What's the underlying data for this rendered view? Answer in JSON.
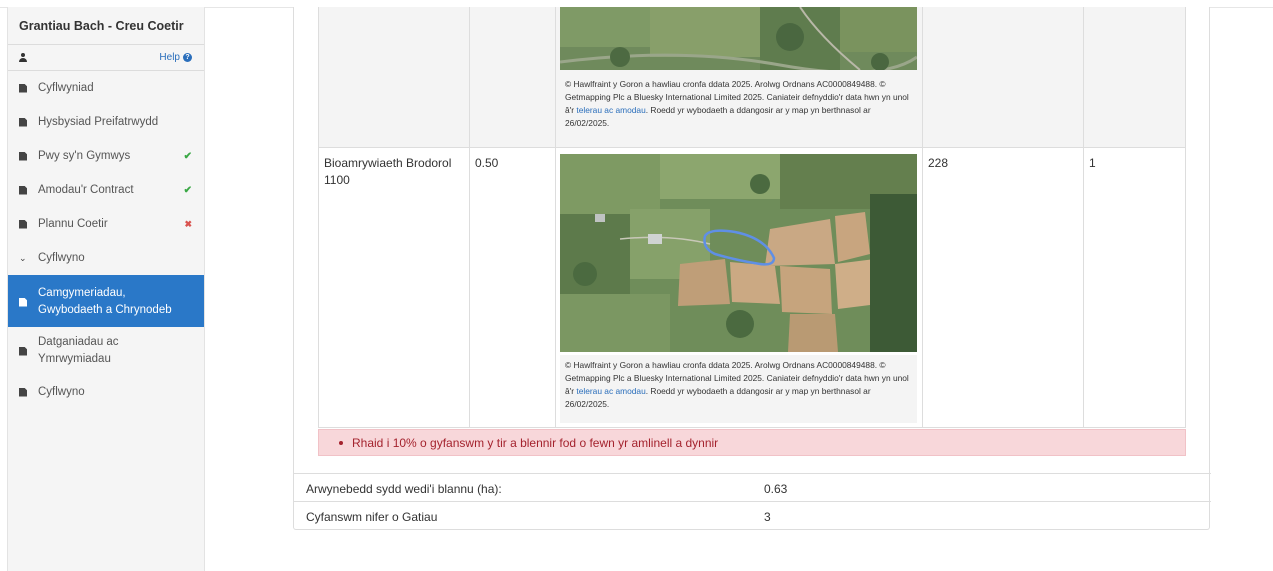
{
  "sidebar": {
    "title": "Grantiau Bach - Creu Coetir",
    "help_label": "Help",
    "items": [
      {
        "label": "Cyflwyniad",
        "status": ""
      },
      {
        "label": "Hysbysiad Preifatrwydd",
        "status": ""
      },
      {
        "label": "Pwy sy'n Gymwys",
        "status": "✔"
      },
      {
        "label": "Amodau'r Contract",
        "status": "✔"
      },
      {
        "label": "Plannu Coetir",
        "status": "✖"
      },
      {
        "label": "Cyflwyno",
        "status": ""
      },
      {
        "label": "Camgymeriadau, Gwybodaeth a Chrynodeb",
        "status": ""
      },
      {
        "label": "Datganiadau ac Ymrwymiadau",
        "status": ""
      },
      {
        "label": "Cyflwyno",
        "status": ""
      }
    ]
  },
  "table": {
    "rows": [
      {
        "name": "",
        "area": "",
        "caption_text": "© Hawlfraint y Goron a hawliau cronfa ddata 2025. Arolwg Ordnans AC0000849488. © Getmapping Plc a Bluesky International Limited 2025. Caniateir defnyddio'r data hwn yn unol â'r ",
        "caption_link": "telerau ac amodau",
        "caption_tail": ". Roedd yr wybodaeth a ddangosir ar y map yn berthnasol ar 26/02/2025.",
        "col4": "",
        "col5": ""
      },
      {
        "name": "Bioamrywiaeth Brodorol 1100",
        "area": "0.50",
        "caption_text": "© Hawlfraint y Goron a hawliau cronfa ddata 2025. Arolwg Ordnans AC0000849488. © Getmapping Plc a Bluesky International Limited 2025. Caniateir defnyddio'r data hwn yn unol â'r ",
        "caption_link": "telerau ac amodau",
        "caption_tail": ". Roedd yr wybodaeth a ddangosir ar y map yn berthnasol ar 26/02/2025.",
        "col4": "228",
        "col5": "1"
      }
    ]
  },
  "alert": {
    "message": "Rhaid i 10% o gyfanswm y tir a blennir fod o fewn yr amlinell a dynnir"
  },
  "summary": {
    "planted_label": "Arwynebedd sydd wedi'i blannu (ha):",
    "planted_value": "0.63",
    "gates_label": "Cyfanswm nifer o Gatiau",
    "gates_value": "3"
  },
  "icons": {
    "user": "user-icon",
    "help": "help-icon",
    "document": "document-icon",
    "check": "check-icon",
    "cross": "cross-icon",
    "chevron": "chevron-down-icon"
  },
  "colors": {
    "active": "#2a78c8",
    "ok": "#3aa845",
    "error": "#d9534f",
    "alert_bg": "#f8d7da",
    "link": "#2a6ebb"
  }
}
